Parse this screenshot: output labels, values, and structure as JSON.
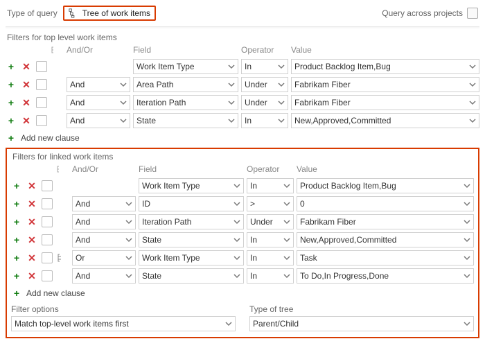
{
  "header": {
    "type_label": "Type of query",
    "query_type": "Tree of work items",
    "cross_label": "Query across projects"
  },
  "top": {
    "title": "Filters for top level work items",
    "head": {
      "andor": "And/Or",
      "field": "Field",
      "op": "Operator",
      "val": "Value"
    },
    "rows": [
      {
        "andor": "",
        "field": "Work Item Type",
        "op": "In",
        "val": "Product Backlog Item,Bug"
      },
      {
        "andor": "And",
        "field": "Area Path",
        "op": "Under",
        "val": "Fabrikam Fiber"
      },
      {
        "andor": "And",
        "field": "Iteration Path",
        "op": "Under",
        "val": "Fabrikam Fiber"
      },
      {
        "andor": "And",
        "field": "State",
        "op": "In",
        "val": "New,Approved,Committed"
      }
    ],
    "add": "Add new clause"
  },
  "linked": {
    "title": "Filters for linked work items",
    "head": {
      "andor": "And/Or",
      "field": "Field",
      "op": "Operator",
      "val": "Value"
    },
    "rows": [
      {
        "andor": "",
        "field": "Work Item Type",
        "op": "In",
        "val": "Product Backlog Item,Bug",
        "group": false
      },
      {
        "andor": "And",
        "field": "ID",
        "op": ">",
        "val": "0",
        "group": false
      },
      {
        "andor": "And",
        "field": "Iteration Path",
        "op": "Under",
        "val": "Fabrikam Fiber",
        "group": false
      },
      {
        "andor": "And",
        "field": "State",
        "op": "In",
        "val": "New,Approved,Committed",
        "group": false
      },
      {
        "andor": "Or",
        "field": "Work Item Type",
        "op": "In",
        "val": "Task",
        "group": true
      },
      {
        "andor": "And",
        "field": "State",
        "op": "In",
        "val": "To Do,In Progress,Done",
        "group": false
      }
    ],
    "add": "Add new clause"
  },
  "bottom": {
    "filter_label": "Filter options",
    "filter_value": "Match top-level work items first",
    "tree_label": "Type of tree",
    "tree_value": "Parent/Child"
  }
}
